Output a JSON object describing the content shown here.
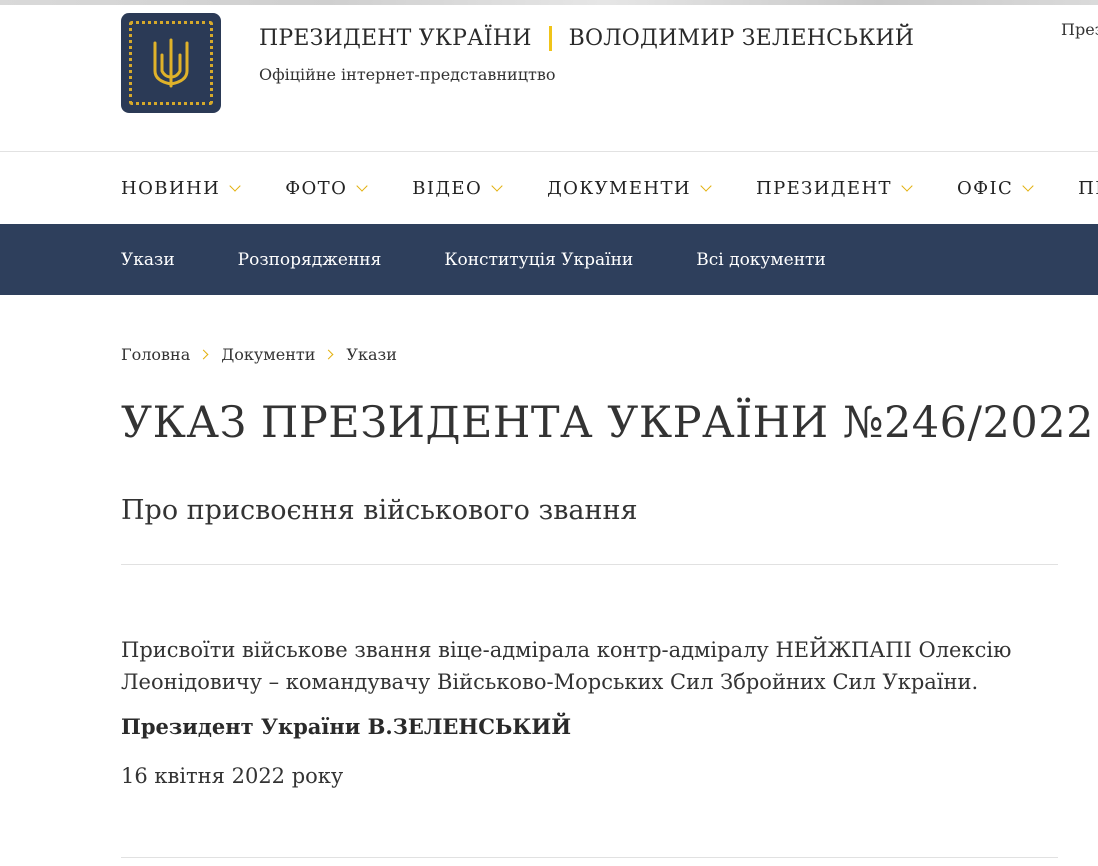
{
  "header": {
    "title_president": "ПРЕЗИДЕНТ УКРАЇНИ",
    "title_name": "ВОЛОДИМИР ЗЕЛЕНСЬКИЙ",
    "subtitle": "Офіційне інтернет-представництво",
    "corner_link": "През",
    "logo_icon": "trident-coat-of-arms-icon",
    "accent_color": "#f0c419"
  },
  "main_nav": {
    "items": [
      {
        "label": "НОВИНИ"
      },
      {
        "label": "ФОТО"
      },
      {
        "label": "ВІДЕО"
      },
      {
        "label": "ДОКУМЕНТИ"
      },
      {
        "label": "ПРЕЗИДЕНТ"
      },
      {
        "label": "ОФІС"
      },
      {
        "label": "ПРЕС-"
      }
    ]
  },
  "sub_nav": {
    "background": "#2e3f5c",
    "items": [
      {
        "label": "Укази"
      },
      {
        "label": "Розпорядження"
      },
      {
        "label": "Конституція України"
      },
      {
        "label": "Всі документи"
      }
    ]
  },
  "breadcrumb": {
    "items": [
      {
        "label": "Головна"
      },
      {
        "label": "Документи"
      },
      {
        "label": "Укази"
      }
    ]
  },
  "document": {
    "title": "УКАЗ ПРЕЗИДЕНТА УКРАЇНИ №246/2022",
    "subtitle": "Про присвоєння військового звання",
    "body": "Присвоїти військове звання віце-адмірала контр-адміралу НЕЙЖПАПІ Олексію Леонідовичу – командувачу Військово-Морських Сил Збройних Сил України.",
    "signature": "Президент України В.ЗЕЛЕНСЬКИЙ",
    "date": "16 квітня 2022 року"
  }
}
